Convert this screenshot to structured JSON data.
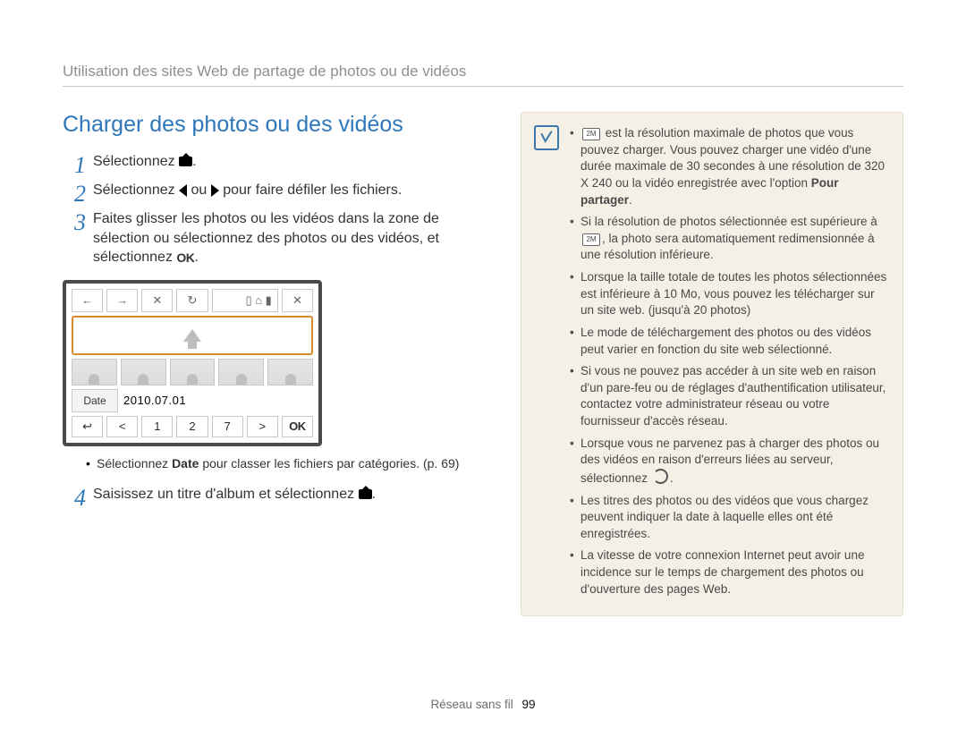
{
  "running_head": "Utilisation des sites Web de partage de photos ou de vidéos",
  "section_title": "Charger des photos ou des vidéos",
  "steps": {
    "s1": "Sélectionnez",
    "s2_a": "Sélectionnez",
    "s2_b": "ou",
    "s2_c": "pour faire défiler les fichiers.",
    "s3": "Faites glisser les photos ou les vidéos dans la zone de sélection ou sélectionnez des photos ou des vidéos, et sélectionnez",
    "s4_a": "Saisissez un titre d'album et sélectionnez"
  },
  "screen": {
    "date_label": "Date",
    "date_value": "2010.07.01",
    "nav": {
      "p1": "1",
      "p2": "2",
      "p3": "7",
      "ok": "OK"
    }
  },
  "subnote": {
    "a": "Sélectionnez",
    "b": "Date",
    "c": "pour classer les fichiers par catégories. (p. 69)"
  },
  "notes": {
    "n1_a": "est la résolution maximale de photos que vous pouvez charger. Vous pouvez charger une vidéo d'une durée maximale de 30 secondes à une résolution de 320 X 240 ou la vidéo enregistrée avec l'option",
    "n1_b": "Pour partager",
    "n1_c": ".",
    "n1_icon": "2M",
    "n2_a": "Si la résolution de photos sélectionnée est supérieure à",
    "n2_b": ", la photo sera automatiquement redimensionnée à une résolution inférieure.",
    "n2_icon": "2M",
    "n3": "Lorsque la taille totale de toutes les photos sélectionnées est inférieure à 10 Mo, vous pouvez les télécharger sur un site web. (jusqu'à 20 photos)",
    "n4": "Le mode de téléchargement des photos ou des vidéos peut varier en fonction du site web sélectionné.",
    "n5": "Si vous ne pouvez pas accéder à un site web en raison d'un pare-feu ou de réglages d'authentification utilisateur, contactez votre administrateur réseau ou votre fournisseur d'accès réseau.",
    "n6_a": "Lorsque vous ne parvenez pas à charger des photos ou des vidéos en raison d'erreurs liées au serveur, sélectionnez",
    "n6_b": ".",
    "n7": "Les titres des photos ou des vidéos que vous chargez peuvent indiquer la date à laquelle elles ont été enregistrées.",
    "n8": "La vitesse de votre connexion Internet peut avoir une incidence sur le temps de chargement des photos ou d'ouverture des pages Web."
  },
  "footer": {
    "section": "Réseau sans fil",
    "page": "99"
  }
}
